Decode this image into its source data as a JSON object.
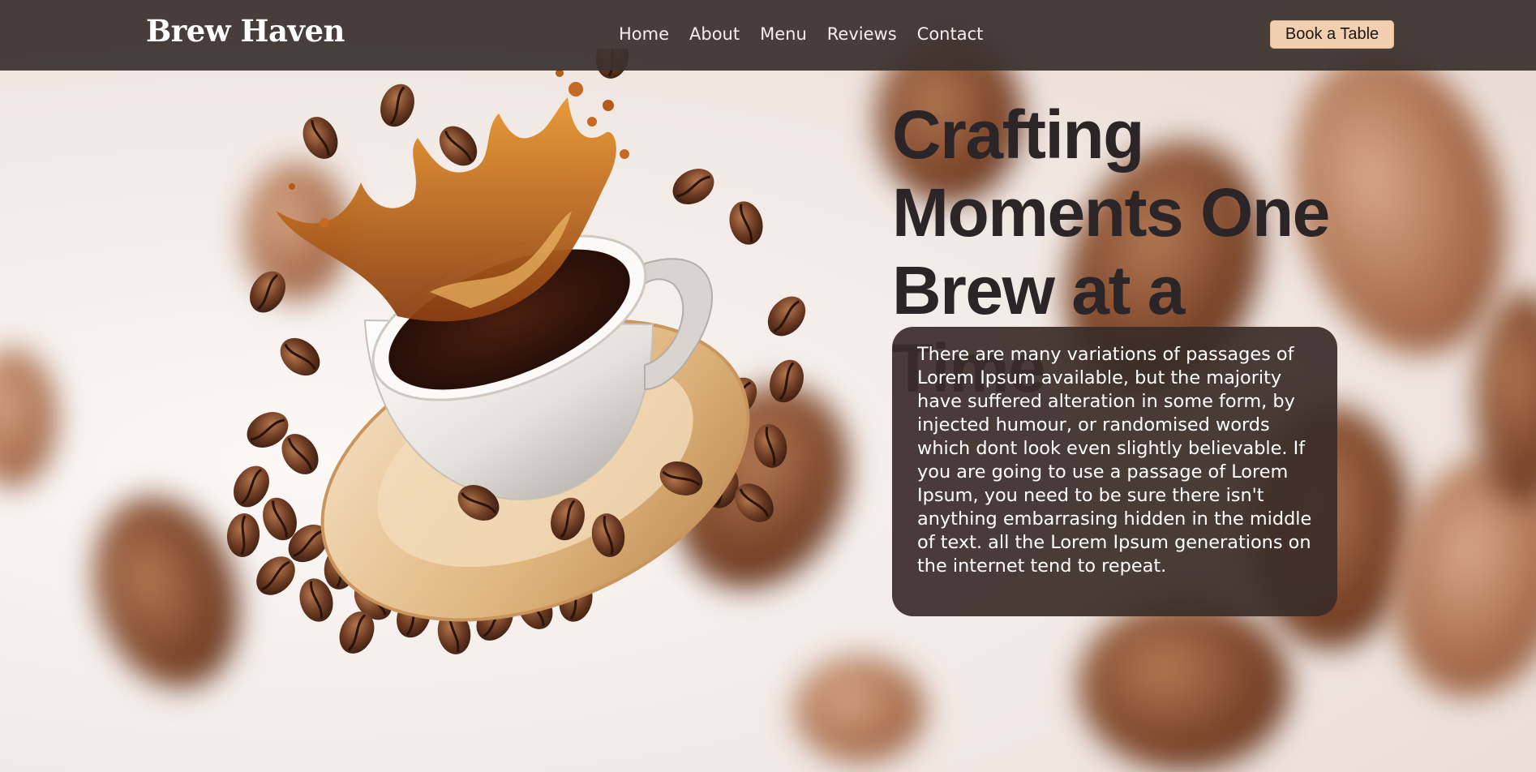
{
  "brand": "Brew Haven",
  "nav": [
    "Home",
    "About",
    "Menu",
    "Reviews",
    "Contact"
  ],
  "cta_label": "Book a Table",
  "hero": {
    "headline_lines": [
      "Crafting",
      "Moments One",
      "Brew at a Time"
    ],
    "body": "There are many variations of passages of Lorem Ipsum available, but the majority have suffered alteration in some form, by injected humour, or randomised words which dont look even slightly believable. If you are going to use a passage of Lorem Ipsum, you need to be sure there isn't anything embarrasing hidden in the middle of text. all the Lorem Ipsum generations on the internet tend to repeat."
  },
  "colors": {
    "header_bg": "#3a322e",
    "cta_bg": "#f3cfb2",
    "copy_box_bg": "#3a2d28",
    "headline": "#2b2527"
  },
  "icons": [
    "coffee-cup-splash-illustration",
    "coffee-bean-icon"
  ]
}
